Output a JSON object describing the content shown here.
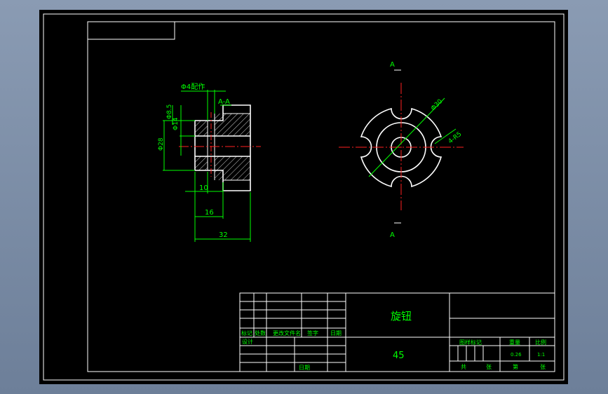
{
  "drawing": {
    "part_name": "旋钮",
    "material": "45",
    "section_label": "A-A",
    "view_labels": [
      "A",
      "A"
    ],
    "dimensions": {
      "note_hole": "Φ4配作",
      "d_inner1": "Φ14",
      "d_inner2": "Φ8.5",
      "d_outer": "Φ28",
      "depth10": "10",
      "depth16": "16",
      "length32": "32",
      "d_pitch": "Φ30",
      "notch": "4-R5"
    },
    "title_block": {
      "labels": {
        "mark": "标记",
        "count": "处数",
        "change_doc": "更改文件名",
        "sign": "签字",
        "date": "日期",
        "design": "设计",
        "date2": "日期",
        "stage_mark": "图样标记",
        "weight": "重量",
        "scale": "比例",
        "total": "共",
        "sheet": "张",
        "page": "第",
        "sheet2": "张"
      },
      "weight_value": "0.26",
      "scale_value": "1:1"
    }
  }
}
